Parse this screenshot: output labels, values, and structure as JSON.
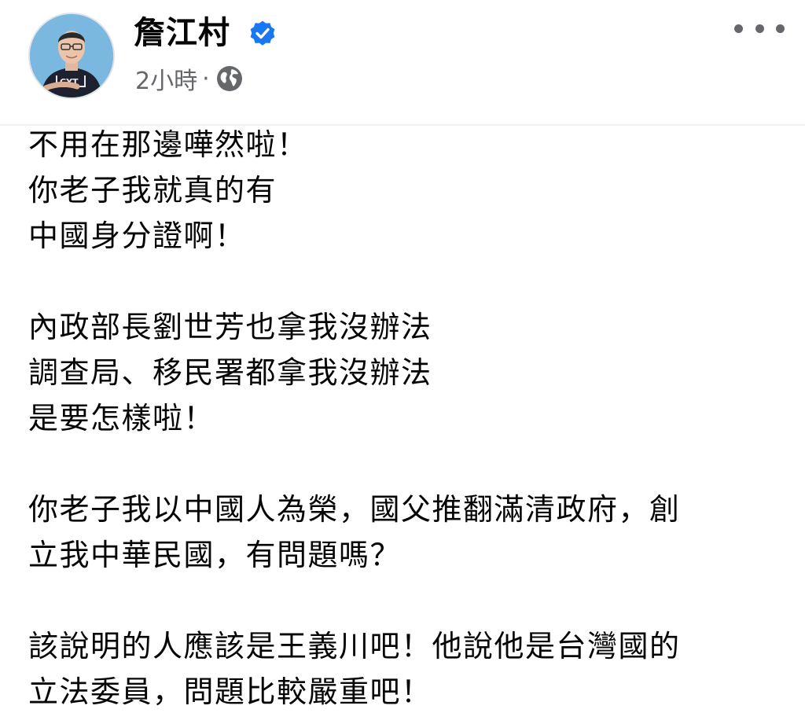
{
  "post": {
    "author": "詹江村",
    "verified_icon": "verified-badge-icon",
    "time": "2小時",
    "separator": "·",
    "audience_icon": "globe-icon",
    "more_icon": "more-options-icon",
    "paragraphs": [
      [
        "不用在那邊嘩然啦！",
        "你老子我就真的有",
        "中國身分證啊！"
      ],
      [
        "內政部長劉世芳也拿我沒辦法",
        "調查局、移民署都拿我沒辦法",
        "是要怎樣啦！"
      ],
      [
        "你老子我以中國人為榮，國父推翻滿清政府，創",
        "立我中華民國，有問題嗎？"
      ],
      [
        "該說明的人應該是王義川吧！他說他是台灣國的",
        "立法委員，問題比較嚴重吧！"
      ]
    ]
  },
  "colors": {
    "verified": "#1877f2",
    "meta_text": "#65676b",
    "body_text": "#050505"
  }
}
